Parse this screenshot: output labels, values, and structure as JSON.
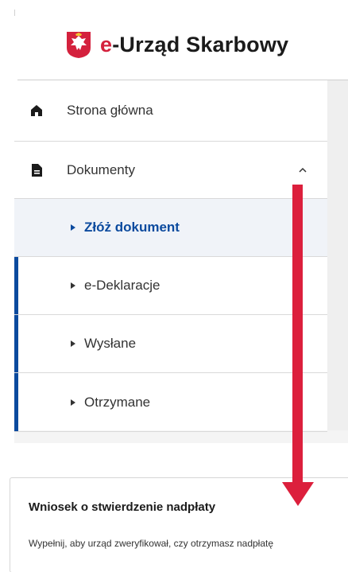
{
  "header": {
    "brand_prefix": "e",
    "brand_suffix": "-Urząd Skarbowy"
  },
  "nav": {
    "items": [
      {
        "label": "Strona główna",
        "icon": "home-icon"
      },
      {
        "label": "Dokumenty",
        "icon": "document-icon",
        "expanded": true
      }
    ],
    "sub_items": [
      {
        "label": "Złóż dokument",
        "active": true
      },
      {
        "label": "e-Deklaracje"
      },
      {
        "label": "Wysłane"
      },
      {
        "label": "Otrzymane"
      }
    ]
  },
  "card": {
    "title": "Wniosek o stwierdzenie nadpłaty",
    "description": "Wypełnij, aby urząd zweryfikował, czy otrzymasz nadpłatę"
  },
  "colors": {
    "brand_red": "#d4213d",
    "active_blue": "#0b4a9e",
    "arrow_red": "#dc1f3c"
  }
}
